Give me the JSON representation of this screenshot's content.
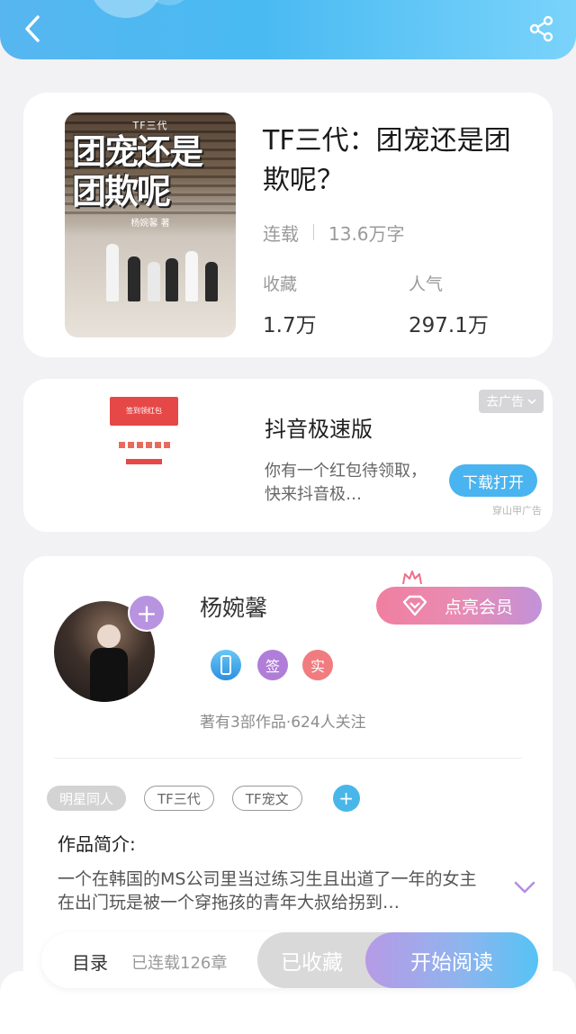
{
  "book": {
    "cover_series": "TF三代",
    "cover_title": "团宠还是团欺呢",
    "cover_author": "杨婉馨 著",
    "title": "TF三代：团宠还是团欺呢？",
    "status": "连载",
    "word_count": "13.6万字",
    "favorites_label": "收藏",
    "favorites_value": "1.7万",
    "popularity_label": "人气",
    "popularity_value": "297.1万"
  },
  "ad": {
    "close_label": "去广告",
    "thumb_text": "签到领红包",
    "title": "抖音极速版",
    "description": "你有一个红包待领取，快来抖音极…",
    "cta": "下载打开",
    "source": "穿山甲广告"
  },
  "author": {
    "name": "杨婉馨",
    "vip_label": "点亮会员",
    "badge_sign": "签",
    "badge_real": "实",
    "stats": "著有3部作品·624人关注"
  },
  "tags": [
    "明星同人",
    "TF三代",
    "TF宠文"
  ],
  "intro": {
    "label": "作品简介:",
    "text": "一个在韩国的MS公司里当过练习生且出道了一年的女主 在出门玩是被一个穿拖孩的青年大叔给拐到…"
  },
  "bottom_bar": {
    "toc_label": "目录",
    "chapters": "已连载126章",
    "collected_label": "已收藏",
    "read_label": "开始阅读"
  },
  "colors": {
    "header_accent": "#49baf2",
    "vip_pink": "#f07fa0",
    "read_button": "#56c3f4"
  }
}
